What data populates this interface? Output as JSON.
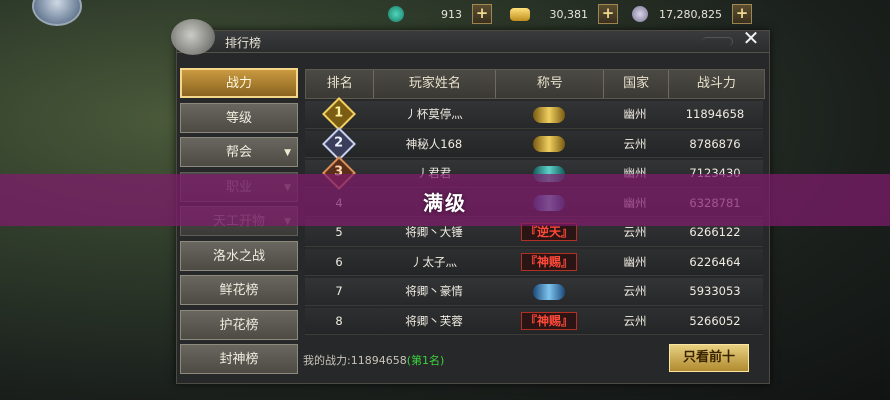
{
  "currencies": [
    {
      "icon": "jade-icon",
      "value": "913"
    },
    {
      "icon": "gold-ingot-icon",
      "value": "30,381"
    },
    {
      "icon": "coin-icon",
      "value": "17,280,825"
    }
  ],
  "panel": {
    "title": "排行榜"
  },
  "menu": [
    {
      "label": "战力",
      "active": true
    },
    {
      "label": "等级"
    },
    {
      "label": "帮会",
      "arrow": "▼"
    },
    {
      "label": "职业",
      "arrow": "▼"
    },
    {
      "label": "天工开物",
      "arrow": "▼"
    },
    {
      "label": "洛水之战"
    },
    {
      "label": "鲜花榜"
    },
    {
      "label": "护花榜"
    },
    {
      "label": "封神榜"
    }
  ],
  "table": {
    "headers": [
      "排名",
      "玩家姓名",
      "称号",
      "国家",
      "战斗力"
    ],
    "rows": [
      {
        "rank": "1",
        "name": "丿杯莫停灬",
        "title": "",
        "title_style": "chip-gold",
        "country": "幽州",
        "power": "11894658"
      },
      {
        "rank": "2",
        "name": "神秘人168",
        "title": "",
        "title_style": "chip-gold",
        "country": "云州",
        "power": "8786876"
      },
      {
        "rank": "3",
        "name": "丿君君",
        "title": "",
        "title_style": "chip-teal",
        "country": "幽州",
        "power": "7123430"
      },
      {
        "rank": "4",
        "name": "丿户",
        "title": "",
        "title_style": "chip-blue",
        "country": "幽州",
        "power": "6328781"
      },
      {
        "rank": "5",
        "name": "将卿丶大锤",
        "title": "『逆天』",
        "title_style": "chip-red",
        "country": "云州",
        "power": "6266122"
      },
      {
        "rank": "6",
        "name": "丿太子灬",
        "title": "『神赐』",
        "title_style": "chip-red",
        "country": "幽州",
        "power": "6226464"
      },
      {
        "rank": "7",
        "name": "将卿丶豪情",
        "title": "",
        "title_style": "chip-blue",
        "country": "云州",
        "power": "5933053"
      },
      {
        "rank": "8",
        "name": "将卿丶芙蓉",
        "title": "『神赐』",
        "title_style": "chip-red",
        "country": "云州",
        "power": "5266052"
      }
    ]
  },
  "footer": {
    "my_power_label": "我的战力:",
    "my_power_value": "11894658",
    "my_rank": "(第1名)",
    "top10_button": "只看前十"
  },
  "banner": {
    "text": "满级"
  },
  "colors": {
    "banner": "#801c6c",
    "accent": "#c99a40"
  }
}
